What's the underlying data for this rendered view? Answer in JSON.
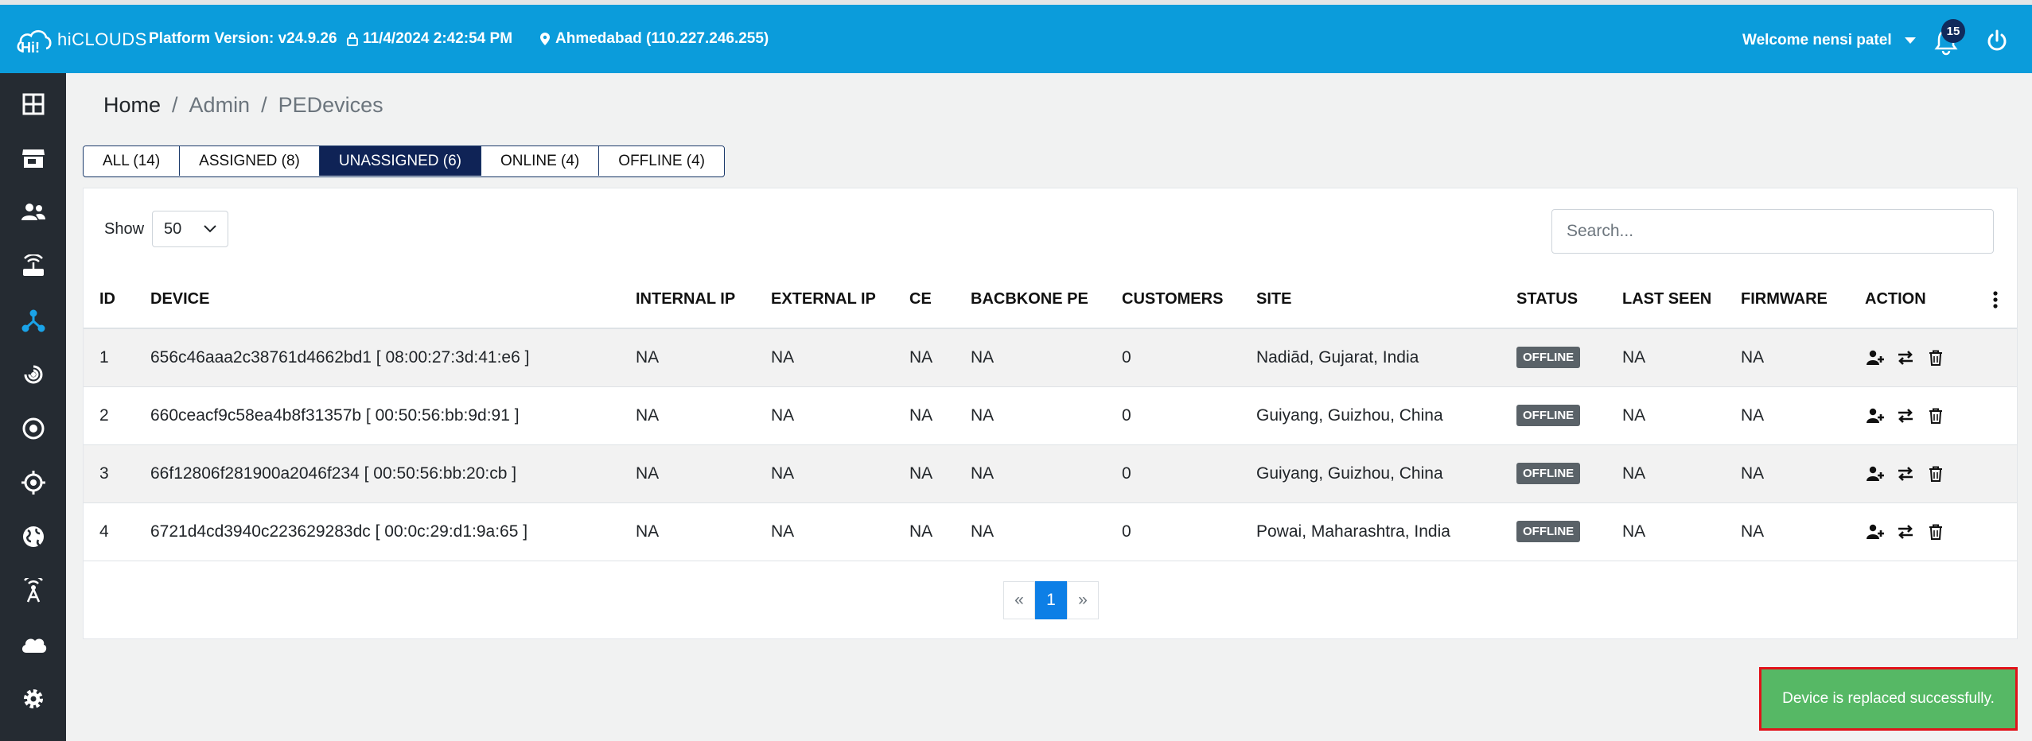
{
  "header": {
    "logo_text": "hiCLOUDS",
    "platform_version": "Platform Version: v24.9.26",
    "datetime": "11/4/2024 2:42:54 PM",
    "location": "Ahmedabad (110.227.246.255)",
    "welcome": "Welcome nensi patel",
    "notification_count": "15",
    "bg_color": "#0b9cdb"
  },
  "sidebar": {
    "items": [
      {
        "icon": "dashboard-grid-icon"
      },
      {
        "icon": "store-icon"
      },
      {
        "icon": "users-icon"
      },
      {
        "icon": "router-icon"
      },
      {
        "icon": "network-nodes-icon",
        "active": true
      },
      {
        "icon": "signal-icon"
      },
      {
        "icon": "target-icon"
      },
      {
        "icon": "crosshair-icon"
      },
      {
        "icon": "globe-icon"
      },
      {
        "icon": "antenna-icon"
      },
      {
        "icon": "cloud-icon"
      },
      {
        "icon": "settings-icon"
      }
    ]
  },
  "breadcrumb": {
    "home": "Home",
    "sep1": "/",
    "admin": "Admin",
    "sep2": "/",
    "current": "PEDevices"
  },
  "tabs": [
    {
      "label": "ALL (14)"
    },
    {
      "label": "ASSIGNED (8)"
    },
    {
      "label": "UNASSIGNED (6)",
      "active": true
    },
    {
      "label": "ONLINE (4)"
    },
    {
      "label": "OFFLINE (4)"
    }
  ],
  "table_controls": {
    "show_label": "Show",
    "page_size": "50",
    "search_placeholder": "Search..."
  },
  "table": {
    "columns": [
      "ID",
      "DEVICE",
      "INTERNAL IP",
      "EXTERNAL IP",
      "CE",
      "BACBKONE PE",
      "CUSTOMERS",
      "SITE",
      "STATUS",
      "LAST SEEN",
      "FIRMWARE",
      "ACTION"
    ],
    "rows": [
      {
        "id": "1",
        "device": "656c46aaa2c38761d4662bd1 [ 08:00:27:3d:41:e6 ]",
        "internal_ip": "NA",
        "external_ip": "NA",
        "ce": "NA",
        "backbone_pe": "NA",
        "customers": "0",
        "site": "Nadiād, Gujarat, India",
        "status": "OFFLINE",
        "last_seen": "NA",
        "firmware": "NA"
      },
      {
        "id": "2",
        "device": "660ceacf9c58ea4b8f31357b [ 00:50:56:bb:9d:91 ]",
        "internal_ip": "NA",
        "external_ip": "NA",
        "ce": "NA",
        "backbone_pe": "NA",
        "customers": "0",
        "site": "Guiyang, Guizhou, China",
        "status": "OFFLINE",
        "last_seen": "NA",
        "firmware": "NA"
      },
      {
        "id": "3",
        "device": "66f12806f281900a2046f234 [ 00:50:56:bb:20:cb ]",
        "internal_ip": "NA",
        "external_ip": "NA",
        "ce": "NA",
        "backbone_pe": "NA",
        "customers": "0",
        "site": "Guiyang, Guizhou, China",
        "status": "OFFLINE",
        "last_seen": "NA",
        "firmware": "NA"
      },
      {
        "id": "4",
        "device": "6721d4cd3940c223629283dc [ 00:0c:29:d1:9a:65 ]",
        "internal_ip": "NA",
        "external_ip": "NA",
        "ce": "NA",
        "backbone_pe": "NA",
        "customers": "0",
        "site": "Powai, Maharashtra, India",
        "status": "OFFLINE",
        "last_seen": "NA",
        "firmware": "NA"
      }
    ]
  },
  "pagination": {
    "prev": "«",
    "current": "1",
    "next": "»"
  },
  "toast": {
    "message": "Device is replaced successfully.",
    "color": "#56b865"
  }
}
